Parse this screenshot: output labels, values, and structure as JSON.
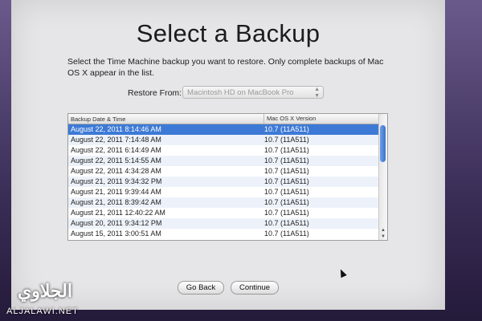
{
  "dialog": {
    "title": "Select a Backup",
    "description": "Select the Time Machine backup you want to restore. Only complete backups of Mac OS X appear in the list.",
    "restore_from_label": "Restore From:",
    "restore_from_value": "Macintosh HD on MacBook Pro"
  },
  "table": {
    "columns": [
      "Backup Date & Time",
      "Mac OS X Version"
    ],
    "rows": [
      {
        "date": "August 22, 2011 8:14:46 AM",
        "version": "10.7 (11A511)",
        "selected": true
      },
      {
        "date": "August 22, 2011 7:14:48 AM",
        "version": "10.7 (11A511)"
      },
      {
        "date": "August 22, 2011 6:14:49 AM",
        "version": "10.7 (11A511)"
      },
      {
        "date": "August 22, 2011 5:14:55 AM",
        "version": "10.7 (11A511)"
      },
      {
        "date": "August 22, 2011 4:34:28 AM",
        "version": "10.7 (11A511)"
      },
      {
        "date": "August 21, 2011 9:34:32 PM",
        "version": "10.7 (11A511)"
      },
      {
        "date": "August 21, 2011 9:39:44 AM",
        "version": "10.7 (11A511)"
      },
      {
        "date": "August 21, 2011 8:39:42 AM",
        "version": "10.7 (11A511)"
      },
      {
        "date": "August 21, 2011 12:40:22 AM",
        "version": "10.7 (11A511)"
      },
      {
        "date": "August 20, 2011 9:34:12 PM",
        "version": "10.7 (11A511)"
      },
      {
        "date": "August 15, 2011 3:00:51 AM",
        "version": "10.7 (11A511)"
      }
    ]
  },
  "buttons": {
    "back": "Go Back",
    "continue": "Continue"
  },
  "watermark": {
    "logo_text": "الجلاوي",
    "site": "ALJALAWI.NET"
  },
  "colors": {
    "selection": "#3d7ad6",
    "alt_row": "#edf2fa"
  }
}
